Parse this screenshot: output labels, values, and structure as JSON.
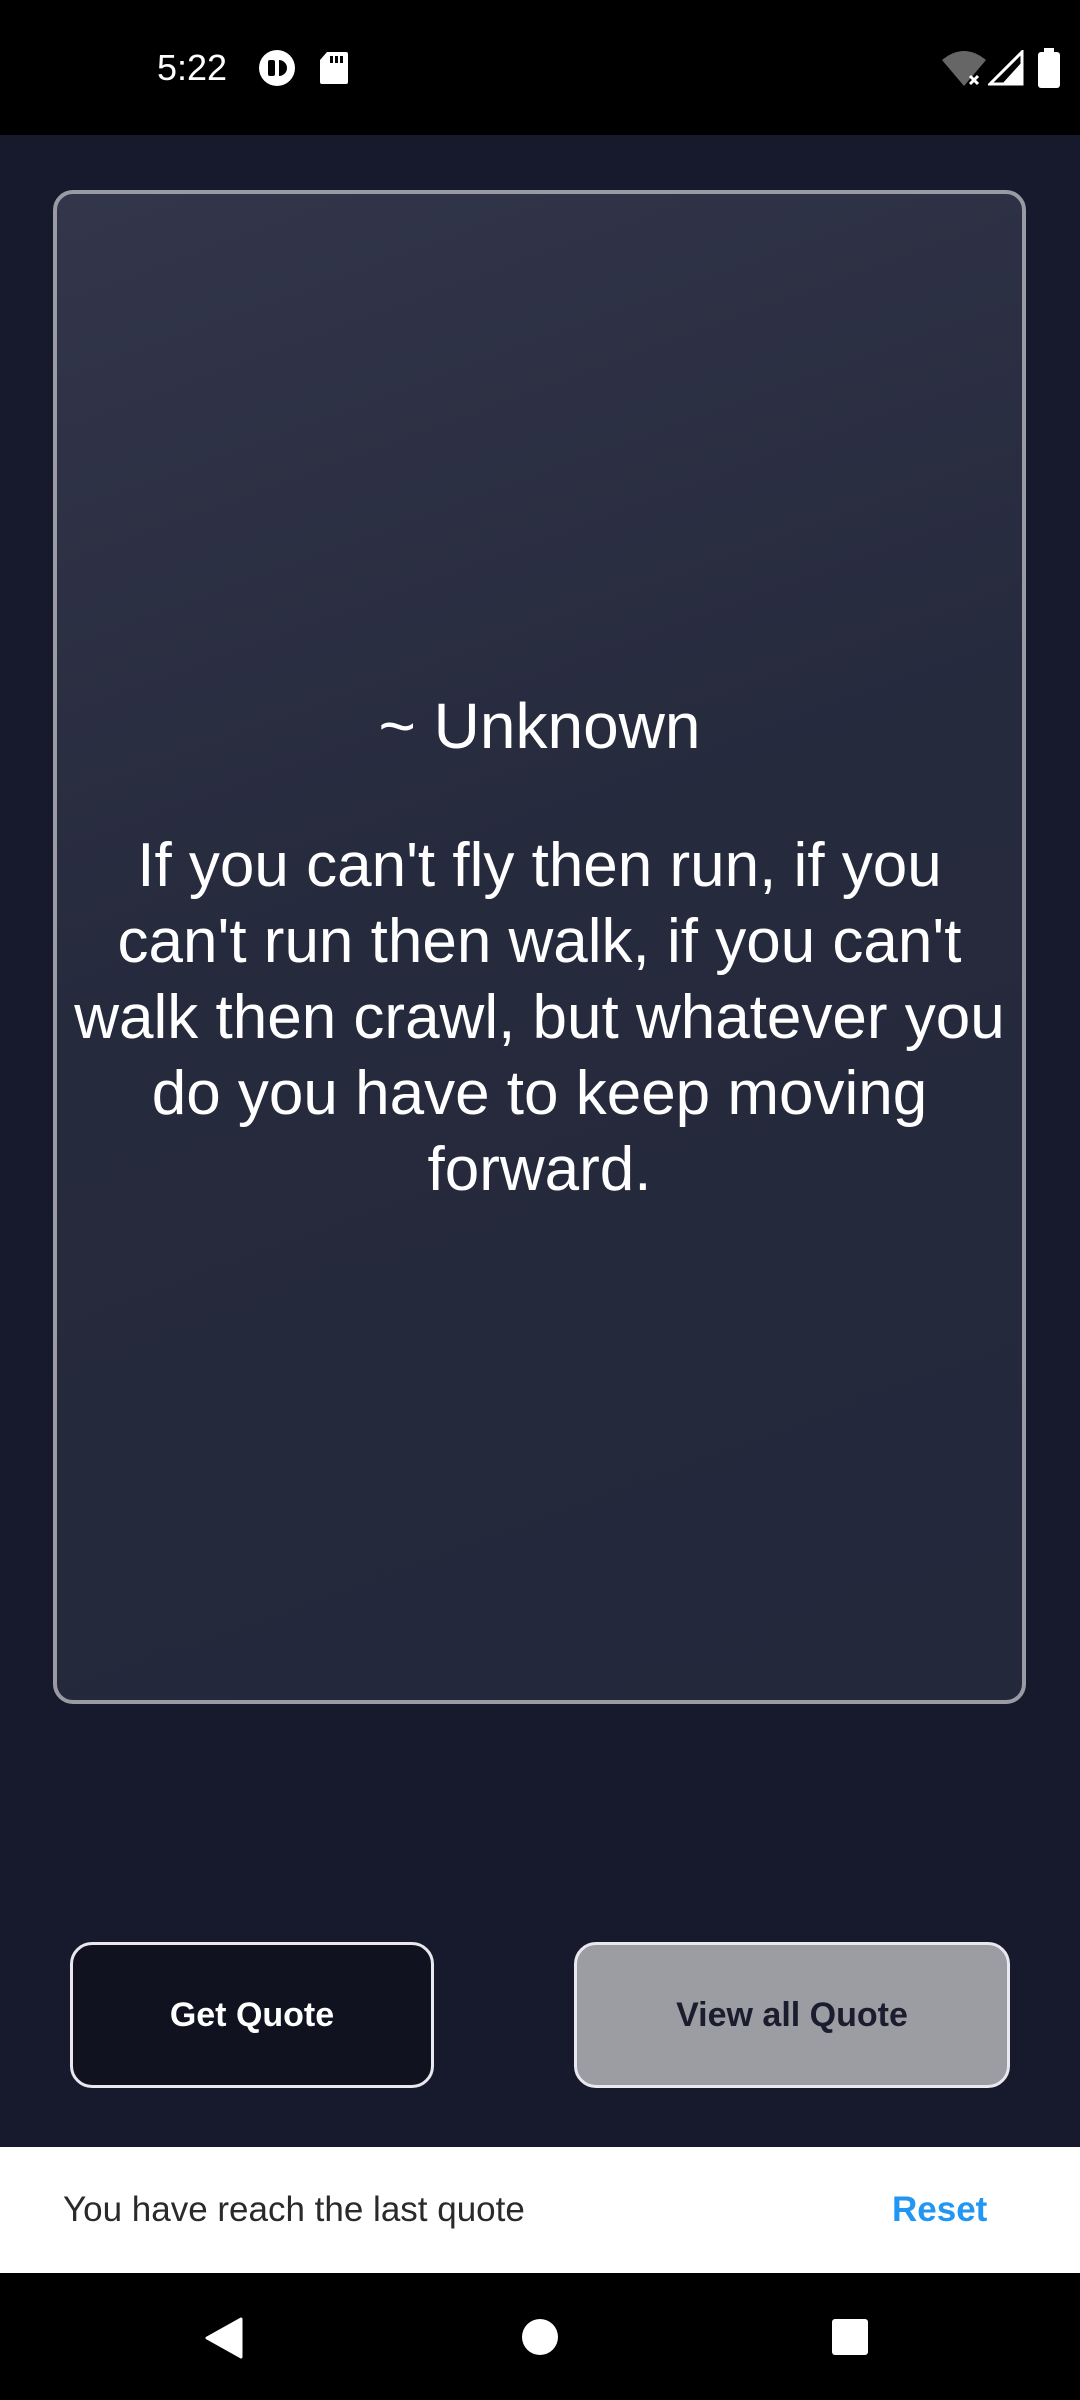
{
  "status_bar": {
    "time": "5:22",
    "icons": [
      "app-notification-icon",
      "sd-card-icon",
      "wifi-off-icon",
      "signal-icon",
      "battery-icon"
    ]
  },
  "quote": {
    "author": "~ Unknown",
    "text": "If you can't fly then run, if you can't run then walk, if you can't walk then crawl, but whatever you do you have to keep moving forward."
  },
  "buttons": {
    "get_quote": "Get Quote",
    "view_all": "View all Quote"
  },
  "snackbar": {
    "message": "You have reach the last quote",
    "action": "Reset"
  },
  "nav_bar": {
    "icons": [
      "back-icon",
      "home-icon",
      "recents-icon"
    ]
  },
  "colors": {
    "background": "#171a2d",
    "card_border": "#9a9aa4",
    "view_button_bg": "#9c9da2",
    "accent": "#2196f3"
  }
}
